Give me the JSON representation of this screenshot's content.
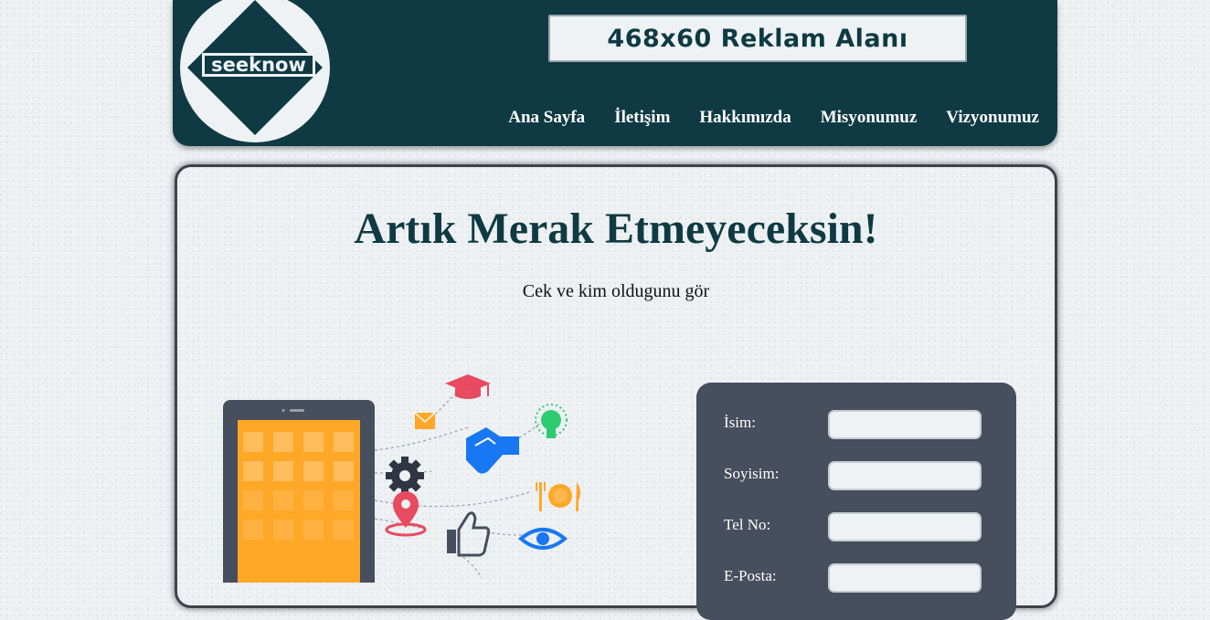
{
  "header": {
    "logo_text": "seeknow",
    "ad_text": "468x60 Reklam Alanı",
    "nav": [
      {
        "label": "Ana Sayfa"
      },
      {
        "label": "İletişim"
      },
      {
        "label": "Hakkımızda"
      },
      {
        "label": "Misyonumuz"
      },
      {
        "label": "Vizyonumuz"
      }
    ]
  },
  "main": {
    "title": "Artık Merak Etmeyeceksin!",
    "subtitle": "Cek ve kim oldugunu gör"
  },
  "form": {
    "fields": [
      {
        "label": "İsim:",
        "value": ""
      },
      {
        "label": "Soyisim:",
        "value": ""
      },
      {
        "label": "Tel No:",
        "value": ""
      },
      {
        "label": "E-Posta:",
        "value": ""
      }
    ]
  },
  "colors": {
    "header_bg": "#0f3a43",
    "form_bg": "#474e5d",
    "title": "#0f3a43",
    "accent_orange": "#ffa726"
  },
  "icons": [
    "graduation-cap-icon",
    "mail-icon",
    "handshake-icon",
    "lightbulb-icon",
    "gear-icon",
    "cutlery-icon",
    "location-pin-icon",
    "thumbs-up-icon",
    "eye-icon",
    "tablet-icon"
  ]
}
